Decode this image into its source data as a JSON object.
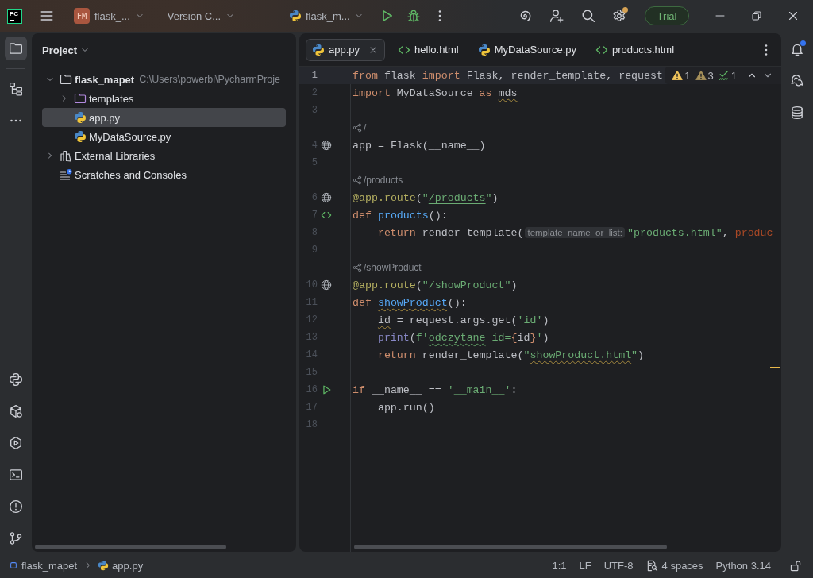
{
  "title_bar": {
    "logo": "PC",
    "project_initials": "FM",
    "project_name": "flask_...",
    "vcs_widget": "Version C...",
    "run_configuration": "flask_m...",
    "settings_has_update": true,
    "trial_button": "Trial"
  },
  "left_toolbar": {
    "top": [
      {
        "selected": true
      },
      {
        "selected": false
      }
    ],
    "bottom": [
      {
        "selected": false
      },
      {
        "selected": false
      },
      {
        "selected": false
      },
      {
        "selected": false
      },
      {
        "selected": false
      },
      {
        "selected": false
      }
    ]
  },
  "project": {
    "title": "Project",
    "tree": [
      {
        "kind": "project",
        "name": "flask_mapet",
        "path": "C:\\Users\\powerbi\\PycharmProje",
        "expanded": true,
        "selected": false,
        "children": [
          {
            "kind": "folder",
            "name": "templates",
            "expanded": false,
            "selected": false
          },
          {
            "kind": "python_file",
            "name": "app.py",
            "selected": true
          },
          {
            "kind": "python_file",
            "name": "MyDataSource.py",
            "selected": false
          }
        ]
      },
      {
        "kind": "libraries",
        "name": "External Libraries",
        "expanded": false,
        "selected": false
      },
      {
        "kind": "scratches",
        "name": "Scratches and Consoles",
        "selected": false
      }
    ]
  },
  "editor": {
    "tabs": [
      {
        "label": "app.py",
        "kind": "python_file",
        "selected": true,
        "closable": true
      },
      {
        "label": "hello.html",
        "kind": "html_file",
        "selected": false,
        "closable": false
      },
      {
        "label": "MyDataSource.py",
        "kind": "python_file",
        "selected": false,
        "closable": false
      },
      {
        "label": "products.html",
        "kind": "html_file",
        "selected": false,
        "closable": false
      }
    ],
    "inspections": [
      {
        "kind": "warning",
        "count": "1"
      },
      {
        "kind": "weak_warning",
        "count": "3"
      },
      {
        "kind": "typo",
        "count": "1"
      }
    ],
    "lines": [
      {
        "kind": "code",
        "number": "1",
        "current": true,
        "indented": false,
        "tokens": [
          {
            "kind": "keyword",
            "text": "from"
          },
          {
            "kind": "plain",
            "text": " flask "
          },
          {
            "kind": "keyword",
            "text": "import"
          },
          {
            "kind": "plain",
            "text": " Flask, render_template, request"
          }
        ]
      },
      {
        "kind": "code",
        "number": "2",
        "current": false,
        "indented": false,
        "tokens": [
          {
            "kind": "keyword",
            "text": "import"
          },
          {
            "kind": "plain",
            "text": " MyDataSource "
          },
          {
            "kind": "keyword",
            "text": "as "
          },
          {
            "kind": "plain",
            "text": "mds",
            "underline": {
              "kind": "warning"
            }
          }
        ]
      },
      {
        "kind": "code",
        "number": "3",
        "current": false
      },
      {
        "kind": "route",
        "text": "/"
      },
      {
        "kind": "code",
        "number": "4",
        "current": false,
        "indented": false,
        "marker": {
          "kind": "endpoint"
        },
        "tokens": [
          {
            "kind": "plain",
            "text": "app = Flask(__name__)"
          }
        ]
      },
      {
        "kind": "code",
        "number": "5",
        "current": false
      },
      {
        "kind": "route",
        "text": "/products"
      },
      {
        "kind": "code",
        "number": "6",
        "current": false,
        "indented": false,
        "marker": {
          "kind": "endpoint"
        },
        "tokens": [
          {
            "kind": "decorator",
            "text": "@app.route"
          },
          {
            "kind": "plain",
            "text": "("
          },
          {
            "kind": "string",
            "text": "\""
          },
          {
            "kind": "string",
            "text": "/products",
            "underline": {
              "kind": "link"
            }
          },
          {
            "kind": "string",
            "text": "\""
          },
          {
            "kind": "plain",
            "text": ")"
          }
        ]
      },
      {
        "kind": "code",
        "number": "7",
        "current": false,
        "indented": false,
        "marker": {
          "kind": "template"
        },
        "tokens": [
          {
            "kind": "keyword",
            "text": "def "
          },
          {
            "kind": "function",
            "text": "products"
          },
          {
            "kind": "plain",
            "text": "():"
          }
        ]
      },
      {
        "kind": "code",
        "number": "8",
        "current": false,
        "indented": true,
        "tokens": [
          {
            "kind": "keyword",
            "text": "return"
          },
          {
            "kind": "plain",
            "text": " render_template("
          },
          {
            "kind": "param_hint",
            "text": "template_name_or_list:"
          },
          {
            "kind": "string",
            "text": "\"products.html\""
          },
          {
            "kind": "plain",
            "text": ", "
          },
          {
            "kind": "named_arg",
            "text": "produc"
          }
        ]
      },
      {
        "kind": "code",
        "number": "9",
        "current": false
      },
      {
        "kind": "route",
        "text": "/showProduct"
      },
      {
        "kind": "code",
        "number": "10",
        "current": false,
        "indented": false,
        "marker": {
          "kind": "endpoint"
        },
        "tokens": [
          {
            "kind": "decorator",
            "text": "@app.route"
          },
          {
            "kind": "plain",
            "text": "("
          },
          {
            "kind": "string",
            "text": "\""
          },
          {
            "kind": "string",
            "text": "/showProduct",
            "underline": {
              "kind": "link"
            }
          },
          {
            "kind": "string",
            "text": "\""
          },
          {
            "kind": "plain",
            "text": ")"
          }
        ]
      },
      {
        "kind": "code",
        "number": "11",
        "current": false,
        "indented": false,
        "tokens": [
          {
            "kind": "keyword",
            "text": "def "
          },
          {
            "kind": "function",
            "text": "showProduct",
            "underline": {
              "kind": "warning"
            }
          },
          {
            "kind": "plain",
            "text": "():"
          }
        ]
      },
      {
        "kind": "code",
        "number": "12",
        "current": false,
        "indented": true,
        "tokens": [
          {
            "kind": "plain",
            "text": "id",
            "underline": {
              "kind": "warning"
            }
          },
          {
            "kind": "plain",
            "text": " = request.args.get("
          },
          {
            "kind": "string",
            "text": "'id'"
          },
          {
            "kind": "plain",
            "text": ")"
          }
        ]
      },
      {
        "kind": "code",
        "number": "13",
        "current": false,
        "indented": true,
        "tokens": [
          {
            "kind": "builtin",
            "text": "print"
          },
          {
            "kind": "plain",
            "text": "("
          },
          {
            "kind": "string",
            "text": "f'"
          },
          {
            "kind": "string",
            "text": "odczytane",
            "underline": {
              "kind": "typo"
            }
          },
          {
            "kind": "string",
            "text": " id="
          },
          {
            "kind": "brace",
            "text": "{"
          },
          {
            "kind": "plain",
            "text": "id"
          },
          {
            "kind": "brace",
            "text": "}"
          },
          {
            "kind": "string",
            "text": "'"
          },
          {
            "kind": "plain",
            "text": ")"
          }
        ]
      },
      {
        "kind": "code",
        "number": "14",
        "current": false,
        "indented": true,
        "tokens": [
          {
            "kind": "keyword",
            "text": "return"
          },
          {
            "kind": "plain",
            "text": " render_template("
          },
          {
            "kind": "string",
            "text": "\""
          },
          {
            "kind": "string",
            "text": "showProduct.html",
            "underline": {
              "kind": "warning"
            }
          },
          {
            "kind": "string",
            "text": "\""
          },
          {
            "kind": "plain",
            "text": ")"
          }
        ]
      },
      {
        "kind": "code",
        "number": "15",
        "current": false
      },
      {
        "kind": "code",
        "number": "16",
        "current": false,
        "indented": false,
        "marker": {
          "kind": "run"
        },
        "tokens": [
          {
            "kind": "keyword",
            "text": "if"
          },
          {
            "kind": "plain",
            "text": " __name__ == "
          },
          {
            "kind": "string",
            "text": "'__main__'"
          },
          {
            "kind": "plain",
            "text": ":"
          }
        ]
      },
      {
        "kind": "code",
        "number": "17",
        "current": false,
        "indented": true,
        "tokens": [
          {
            "kind": "plain",
            "text": "app.run()"
          }
        ]
      },
      {
        "kind": "code",
        "number": "18",
        "current": false
      }
    ]
  },
  "right_toolbar": {
    "notifications_unread": true
  },
  "status_bar": {
    "breadcrumbs": [
      {
        "kind": "module",
        "label": "flask_mapet"
      },
      {
        "kind": "python_file",
        "label": "app.py"
      }
    ],
    "caret_position": "1:1",
    "line_separator": "LF",
    "encoding": "UTF-8",
    "indent": "4 spaces",
    "interpreter": "Python 3.14"
  }
}
